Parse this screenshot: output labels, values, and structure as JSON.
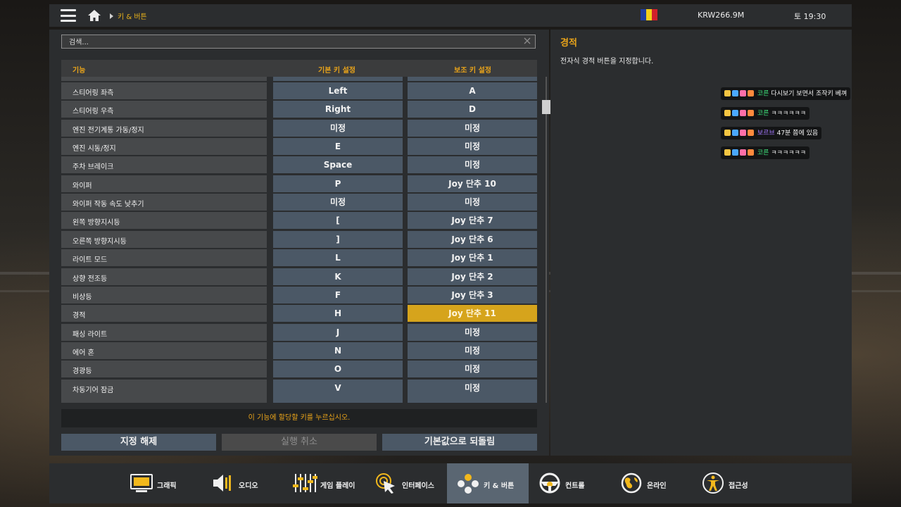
{
  "topbar": {
    "breadcrumb": "키 & 버튼",
    "money": "KRW266.9M",
    "clock": "토 19:30",
    "flag_colors": [
      "#1f3fa0",
      "#f3d11a",
      "#d11f2b"
    ]
  },
  "search": {
    "placeholder": "검색..."
  },
  "table": {
    "headers": {
      "function": "기능",
      "primary": "기본 키 설정",
      "secondary": "보조 키 설정"
    },
    "rows": [
      {
        "name": "스티어링 좌측",
        "primary": "Left",
        "secondary": "A"
      },
      {
        "name": "스티어링 우측",
        "primary": "Right",
        "secondary": "D"
      },
      {
        "name": "엔진 전기계통 가동/정지",
        "primary": "미정",
        "secondary": "미정"
      },
      {
        "name": "엔진 시동/정지",
        "primary": "E",
        "secondary": "미정"
      },
      {
        "name": "주차 브레이크",
        "primary": "Space",
        "secondary": "미정"
      },
      {
        "name": "와이퍼",
        "primary": "P",
        "secondary": "Joy 단추 10"
      },
      {
        "name": "와이퍼 작동 속도 낮추기",
        "primary": "미정",
        "secondary": "미정"
      },
      {
        "name": "왼쪽 방향지시등",
        "primary": "[",
        "secondary": "Joy 단추 7"
      },
      {
        "name": "오른쪽 방향지시등",
        "primary": "]",
        "secondary": "Joy 단추 6"
      },
      {
        "name": "라이트 모드",
        "primary": "L",
        "secondary": "Joy 단추 1"
      },
      {
        "name": "상향 전조등",
        "primary": "K",
        "secondary": "Joy 단추 2"
      },
      {
        "name": "비상등",
        "primary": "F",
        "secondary": "Joy 단추 3"
      },
      {
        "name": "경적",
        "primary": "H",
        "secondary": "Joy 단추 11",
        "selected": true
      },
      {
        "name": "패싱 라이트",
        "primary": "J",
        "secondary": "미정"
      },
      {
        "name": "에어 혼",
        "primary": "N",
        "secondary": "미정"
      },
      {
        "name": "경광등",
        "primary": "O",
        "secondary": "미정"
      },
      {
        "name": "차동기어 잠금",
        "primary": "V",
        "secondary": "미정"
      }
    ]
  },
  "status_message": "이 기능에 할당할 키를 누르십시오.",
  "buttons": {
    "unassign": "지정 해제",
    "undo": "실행 취소",
    "reset_default": "기본값으로 되돌림"
  },
  "description": {
    "title": "경적",
    "text": "전자식 경적 버튼을 지정합니다."
  },
  "chat": [
    {
      "user": "코른",
      "text": "다시보기 보면서 조작키 베껴",
      "user_color": "green"
    },
    {
      "user": "코른",
      "text": "ㅋㅋㅋㅋㅋㅋ",
      "user_color": "green"
    },
    {
      "user": "보르브",
      "text": "47분 쯤에 있음",
      "user_color": "purple"
    },
    {
      "user": "코른",
      "text": "ㅋㅋㅋㅋㅋㅋ",
      "user_color": "green"
    }
  ],
  "tabs": [
    {
      "label": "그래픽",
      "icon": "monitor-icon"
    },
    {
      "label": "오디오",
      "icon": "speaker-icon"
    },
    {
      "label": "게임 플레이",
      "icon": "sliders-icon"
    },
    {
      "label": "인터페이스",
      "icon": "cursor-icon"
    },
    {
      "label": "키 & 버튼",
      "icon": "buttons-icon",
      "active": true
    },
    {
      "label": "컨트롤",
      "icon": "steering-wheel-icon"
    },
    {
      "label": "온라인",
      "icon": "globe-icon"
    },
    {
      "label": "접근성",
      "icon": "accessibility-icon"
    }
  ],
  "colors": {
    "accent": "#e8a31a",
    "selected_key": "#d6a41c",
    "key_cell": "#4b5866",
    "active_tab": "#5a6672"
  }
}
